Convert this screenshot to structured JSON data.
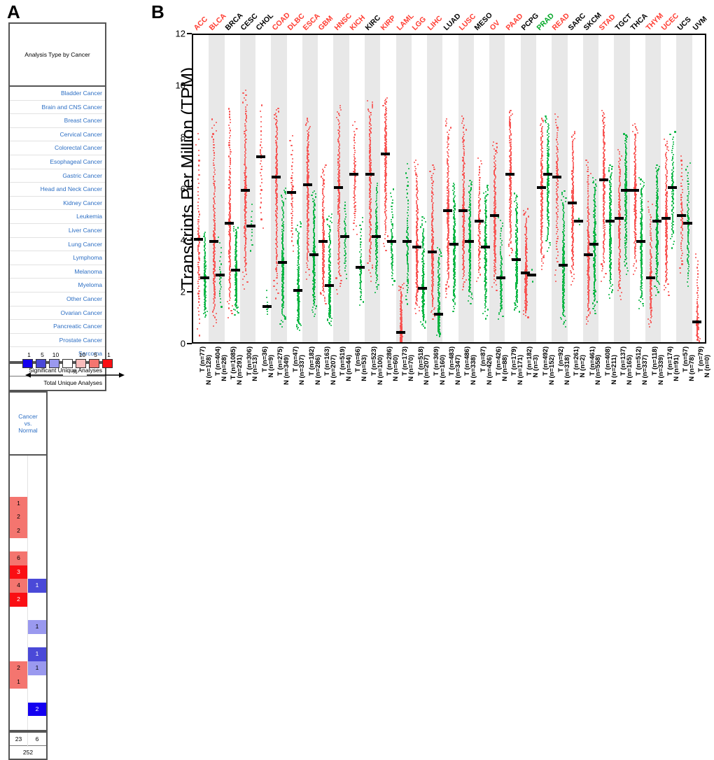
{
  "panelA": {
    "letter": "A",
    "header_left": "Analysis Type by Cancer",
    "header_right": "Cancer\nvs.\nNormal",
    "header_right_lines": [
      "Cancer",
      "vs.",
      "Normal"
    ],
    "rows": [
      {
        "label": "Bladder Cancer",
        "up": "",
        "down": "",
        "up_color": "#ffffff",
        "down_color": "#ffffff"
      },
      {
        "label": "Brain and CNS Cancer",
        "up": "",
        "down": "",
        "up_color": "#ffffff",
        "down_color": "#ffffff"
      },
      {
        "label": "Breast Cancer",
        "up": "",
        "down": "",
        "up_color": "#ffffff",
        "down_color": "#ffffff"
      },
      {
        "label": "Cervical Cancer",
        "up": "1",
        "down": "",
        "up_color": "#f4756f",
        "down_color": "#ffffff"
      },
      {
        "label": "Colorectal Cancer",
        "up": "2",
        "down": "",
        "up_color": "#f4756f",
        "down_color": "#ffffff"
      },
      {
        "label": "Esophageal Cancer",
        "up": "2",
        "down": "",
        "up_color": "#f4756f",
        "down_color": "#ffffff"
      },
      {
        "label": "Gastric Cancer",
        "up": "",
        "down": "",
        "up_color": "#ffffff",
        "down_color": "#ffffff"
      },
      {
        "label": "Head and Neck Cancer",
        "up": "6",
        "down": "",
        "up_color": "#f4756f",
        "down_color": "#ffffff"
      },
      {
        "label": "Kidney Cancer",
        "up": "3",
        "down": "",
        "up_color": "#fa0f14",
        "down_color": "#ffffff"
      },
      {
        "label": "Leukemia",
        "up": "4",
        "down": "1",
        "up_color": "#f4756f",
        "down_color": "#4a49d8"
      },
      {
        "label": "Liver Cancer",
        "up": "2",
        "down": "",
        "up_color": "#fa0f14",
        "down_color": "#ffffff"
      },
      {
        "label": "Lung Cancer",
        "up": "",
        "down": "",
        "up_color": "#ffffff",
        "down_color": "#ffffff"
      },
      {
        "label": "Lymphoma",
        "up": "",
        "down": "1",
        "up_color": "#ffffff",
        "down_color": "#9a99ef"
      },
      {
        "label": "Melanoma",
        "up": "",
        "down": "",
        "up_color": "#ffffff",
        "down_color": "#ffffff"
      },
      {
        "label": "Myeloma",
        "up": "",
        "down": "1",
        "up_color": "#ffffff",
        "down_color": "#4a49d8"
      },
      {
        "label": "Other Cancer",
        "up": "2",
        "down": "1",
        "up_color": "#f4756f",
        "down_color": "#9a99ef"
      },
      {
        "label": "Ovarian Cancer",
        "up": "1",
        "down": "",
        "up_color": "#f4756f",
        "down_color": "#ffffff"
      },
      {
        "label": "Pancreatic Cancer",
        "up": "",
        "down": "",
        "up_color": "#ffffff",
        "down_color": "#ffffff"
      },
      {
        "label": "Prostate Cancer",
        "up": "",
        "down": "2",
        "up_color": "#ffffff",
        "down_color": "#1400f0"
      },
      {
        "label": "Sarcoma",
        "up": "",
        "down": "",
        "up_color": "#ffffff",
        "down_color": "#ffffff"
      }
    ],
    "significant_label": "Significant Unique Analyses",
    "significant_up": "23",
    "significant_down": "6",
    "total_label": "Total Unique Analyses",
    "total_value": "252",
    "legend": {
      "numbers": [
        "1",
        "5",
        "10",
        "",
        "10",
        "5",
        "1"
      ],
      "colors": [
        "#1400f0",
        "#4a49d8",
        "#9a99ef",
        "#ffffff",
        "#f9bcbb",
        "#f4756f",
        "#fa0f14"
      ],
      "axis_label": "%"
    }
  },
  "panelB": {
    "letter": "B",
    "ylabel": "Transcripts Per Million (TPM)",
    "yticks": [
      0,
      2,
      4,
      6,
      8,
      10,
      12
    ]
  },
  "chart_data": {
    "type": "scatter",
    "title": "",
    "xlabel": "",
    "ylabel": "Transcripts Per Million (TPM)",
    "ylim": [
      0,
      12
    ],
    "ytick_values": [
      0,
      2,
      4,
      6,
      8,
      10,
      12
    ],
    "grid": false,
    "legend_position": "none",
    "series_colors": {
      "Tumor": "#f8504f",
      "Normal": "#00b33c",
      "median": "#000000"
    },
    "label_colors": {
      "significant_up": "#ff3b30",
      "significant_down": "#00a626",
      "not_significant": "#000000"
    },
    "groups": [
      {
        "code": "ACC",
        "code_color": "#ff3b30",
        "T": {
          "n": 77,
          "median": 4.1,
          "min": 0.1,
          "max": 8.3
        },
        "N": {
          "n": 128,
          "median": 2.6,
          "min": 1.0,
          "max": 4.4
        }
      },
      {
        "code": "BLCA",
        "code_color": "#ff3b30",
        "T": {
          "n": 404,
          "median": 4.0,
          "min": 0.6,
          "max": 8.8
        },
        "N": {
          "n": 28,
          "median": 2.7,
          "min": 1.3,
          "max": 4.3
        }
      },
      {
        "code": "BRCA",
        "code_color": "#000000",
        "T": {
          "n": 1085,
          "median": 4.7,
          "min": 0.9,
          "max": 9.2
        },
        "N": {
          "n": 291,
          "median": 2.9,
          "min": 1.1,
          "max": 4.6
        }
      },
      {
        "code": "CESC",
        "code_color": "#000000",
        "T": {
          "n": 306,
          "median": 6.0,
          "min": 2.0,
          "max": 9.9
        },
        "N": {
          "n": 13,
          "median": 4.6,
          "min": 3.4,
          "max": 5.6
        }
      },
      {
        "code": "CHOL",
        "code_color": "#000000",
        "T": {
          "n": 36,
          "median": 7.3,
          "min": 4.2,
          "max": 9.4
        },
        "N": {
          "n": 9,
          "median": 1.5,
          "min": 1.1,
          "max": 2.3
        }
      },
      {
        "code": "COAD",
        "code_color": "#ff3b30",
        "T": {
          "n": 275,
          "median": 6.5,
          "min": 1.6,
          "max": 9.2
        },
        "N": {
          "n": 349,
          "median": 3.2,
          "min": 0.6,
          "max": 6.1
        }
      },
      {
        "code": "DLBC",
        "code_color": "#ff3b30",
        "T": {
          "n": 47,
          "median": 5.9,
          "min": 3.4,
          "max": 8.2
        },
        "N": {
          "n": 337,
          "median": 2.1,
          "min": 0.5,
          "max": 4.8
        }
      },
      {
        "code": "ESCA",
        "code_color": "#ff3b30",
        "T": {
          "n": 182,
          "median": 6.2,
          "min": 2.4,
          "max": 8.8
        },
        "N": {
          "n": 286,
          "median": 3.5,
          "min": 1.0,
          "max": 6.0
        }
      },
      {
        "code": "GBM",
        "code_color": "#ff3b30",
        "T": {
          "n": 163,
          "median": 4.0,
          "min": 1.5,
          "max": 7.0
        },
        "N": {
          "n": 207,
          "median": 2.3,
          "min": 0.7,
          "max": 5.1
        }
      },
      {
        "code": "HNSC",
        "code_color": "#ff3b30",
        "T": {
          "n": 519,
          "median": 6.1,
          "min": 1.8,
          "max": 9.3
        },
        "N": {
          "n": 44,
          "median": 4.2,
          "min": 2.4,
          "max": 5.6
        }
      },
      {
        "code": "KICH",
        "code_color": "#ff3b30",
        "T": {
          "n": 66,
          "median": 6.6,
          "min": 4.1,
          "max": 8.7
        },
        "N": {
          "n": 53,
          "median": 3.0,
          "min": 1.4,
          "max": 5.0
        }
      },
      {
        "code": "KIRC",
        "code_color": "#000000",
        "T": {
          "n": 523,
          "median": 6.6,
          "min": 2.3,
          "max": 9.5
        },
        "N": {
          "n": 100,
          "median": 4.2,
          "min": 1.9,
          "max": 6.3
        }
      },
      {
        "code": "KIRP",
        "code_color": "#ff3b30",
        "T": {
          "n": 286,
          "median": 7.4,
          "min": 3.5,
          "max": 9.6
        },
        "N": {
          "n": 60,
          "median": 4.0,
          "min": 2.2,
          "max": 6.1
        }
      },
      {
        "code": "LAML",
        "code_color": "#ff3b30",
        "T": {
          "n": 173,
          "median": 0.5,
          "min": 0.0,
          "max": 2.4
        },
        "N": {
          "n": 70,
          "median": 4.0,
          "min": 1.4,
          "max": 7.1
        }
      },
      {
        "code": "LGG",
        "code_color": "#ff3b30",
        "T": {
          "n": 518,
          "median": 3.8,
          "min": 1.1,
          "max": 7.2
        },
        "N": {
          "n": 207,
          "median": 2.2,
          "min": 0.6,
          "max": 5.0
        }
      },
      {
        "code": "LIHC",
        "code_color": "#ff3b30",
        "T": {
          "n": 369,
          "median": 3.6,
          "min": 0.9,
          "max": 7.0
        },
        "N": {
          "n": 160,
          "median": 1.2,
          "min": 0.3,
          "max": 3.8
        }
      },
      {
        "code": "LUAD",
        "code_color": "#000000",
        "T": {
          "n": 483,
          "median": 5.2,
          "min": 1.7,
          "max": 8.8
        },
        "N": {
          "n": 347,
          "median": 3.9,
          "min": 1.2,
          "max": 6.3
        }
      },
      {
        "code": "LUSC",
        "code_color": "#ff3b30",
        "T": {
          "n": 486,
          "median": 5.2,
          "min": 2.0,
          "max": 8.9
        },
        "N": {
          "n": 338,
          "median": 4.0,
          "min": 1.5,
          "max": 6.4
        }
      },
      {
        "code": "MESO",
        "code_color": "#000000",
        "T": {
          "n": 87,
          "median": 4.8,
          "min": 2.3,
          "max": 7.3
        },
        "N": {
          "n": 426,
          "median": 3.8,
          "min": 0.9,
          "max": 6.2
        }
      },
      {
        "code": "OV",
        "code_color": "#ff3b30",
        "T": {
          "n": 426,
          "median": 5.0,
          "min": 2.0,
          "max": 7.9
        },
        "N": {
          "n": 88,
          "median": 2.6,
          "min": 0.9,
          "max": 5.0
        }
      },
      {
        "code": "PAAD",
        "code_color": "#ff3b30",
        "T": {
          "n": 179,
          "median": 6.6,
          "min": 3.2,
          "max": 9.1
        },
        "N": {
          "n": 171,
          "median": 3.3,
          "min": 1.2,
          "max": 5.9
        }
      },
      {
        "code": "PCPG",
        "code_color": "#000000",
        "T": {
          "n": 182,
          "median": 2.8,
          "min": 1.0,
          "max": 5.3
        },
        "N": {
          "n": 3,
          "median": 2.7,
          "min": 2.2,
          "max": 3.2
        }
      },
      {
        "code": "PRAD",
        "code_color": "#00a626",
        "T": {
          "n": 492,
          "median": 6.1,
          "min": 2.8,
          "max": 8.8
        },
        "N": {
          "n": 152,
          "median": 6.6,
          "min": 3.5,
          "max": 8.9
        }
      },
      {
        "code": "READ",
        "code_color": "#ff3b30",
        "T": {
          "n": 92,
          "median": 6.5,
          "min": 2.2,
          "max": 9.0
        },
        "N": {
          "n": 318,
          "median": 3.1,
          "min": 0.6,
          "max": 6.0
        }
      },
      {
        "code": "SARC",
        "code_color": "#000000",
        "T": {
          "n": 261,
          "median": 5.5,
          "min": 2.2,
          "max": 8.3
        },
        "N": {
          "n": 2,
          "median": 4.8,
          "min": 4.4,
          "max": 5.2
        }
      },
      {
        "code": "SKCM",
        "code_color": "#000000",
        "T": {
          "n": 461,
          "median": 3.5,
          "min": 0.7,
          "max": 7.2
        },
        "N": {
          "n": 558,
          "median": 3.9,
          "min": 1.1,
          "max": 6.5
        }
      },
      {
        "code": "STAD",
        "code_color": "#ff3b30",
        "T": {
          "n": 408,
          "median": 6.4,
          "min": 2.3,
          "max": 9.1
        },
        "N": {
          "n": 211,
          "median": 4.8,
          "min": 1.7,
          "max": 7.0
        }
      },
      {
        "code": "TGCT",
        "code_color": "#000000",
        "T": {
          "n": 137,
          "median": 4.9,
          "min": 1.6,
          "max": 7.6
        },
        "N": {
          "n": 165,
          "median": 6.0,
          "min": 2.6,
          "max": 8.2
        }
      },
      {
        "code": "THCA",
        "code_color": "#000000",
        "T": {
          "n": 512,
          "median": 6.0,
          "min": 2.6,
          "max": 8.6
        },
        "N": {
          "n": 337,
          "median": 4.0,
          "min": 1.3,
          "max": 6.5
        }
      },
      {
        "code": "THYM",
        "code_color": "#ff3b30",
        "T": {
          "n": 118,
          "median": 2.6,
          "min": 0.6,
          "max": 5.6
        },
        "N": {
          "n": 339,
          "median": 4.8,
          "min": 1.8,
          "max": 7.0
        }
      },
      {
        "code": "UCEC",
        "code_color": "#ff3b30",
        "T": {
          "n": 174,
          "median": 4.9,
          "min": 1.8,
          "max": 8.0
        },
        "N": {
          "n": 91,
          "median": 6.1,
          "min": 3.6,
          "max": 8.3
        }
      },
      {
        "code": "UCS",
        "code_color": "#000000",
        "T": {
          "n": 57,
          "median": 5.0,
          "min": 2.6,
          "max": 7.4
        },
        "N": {
          "n": 78,
          "median": 4.7,
          "min": 2.1,
          "max": 7.1
        }
      },
      {
        "code": "UVM",
        "code_color": "#000000",
        "T": {
          "n": 79,
          "median": 0.9,
          "min": 0.1,
          "max": 3.6
        },
        "N": {
          "n": 0,
          "median": null,
          "min": null,
          "max": null
        }
      }
    ]
  }
}
